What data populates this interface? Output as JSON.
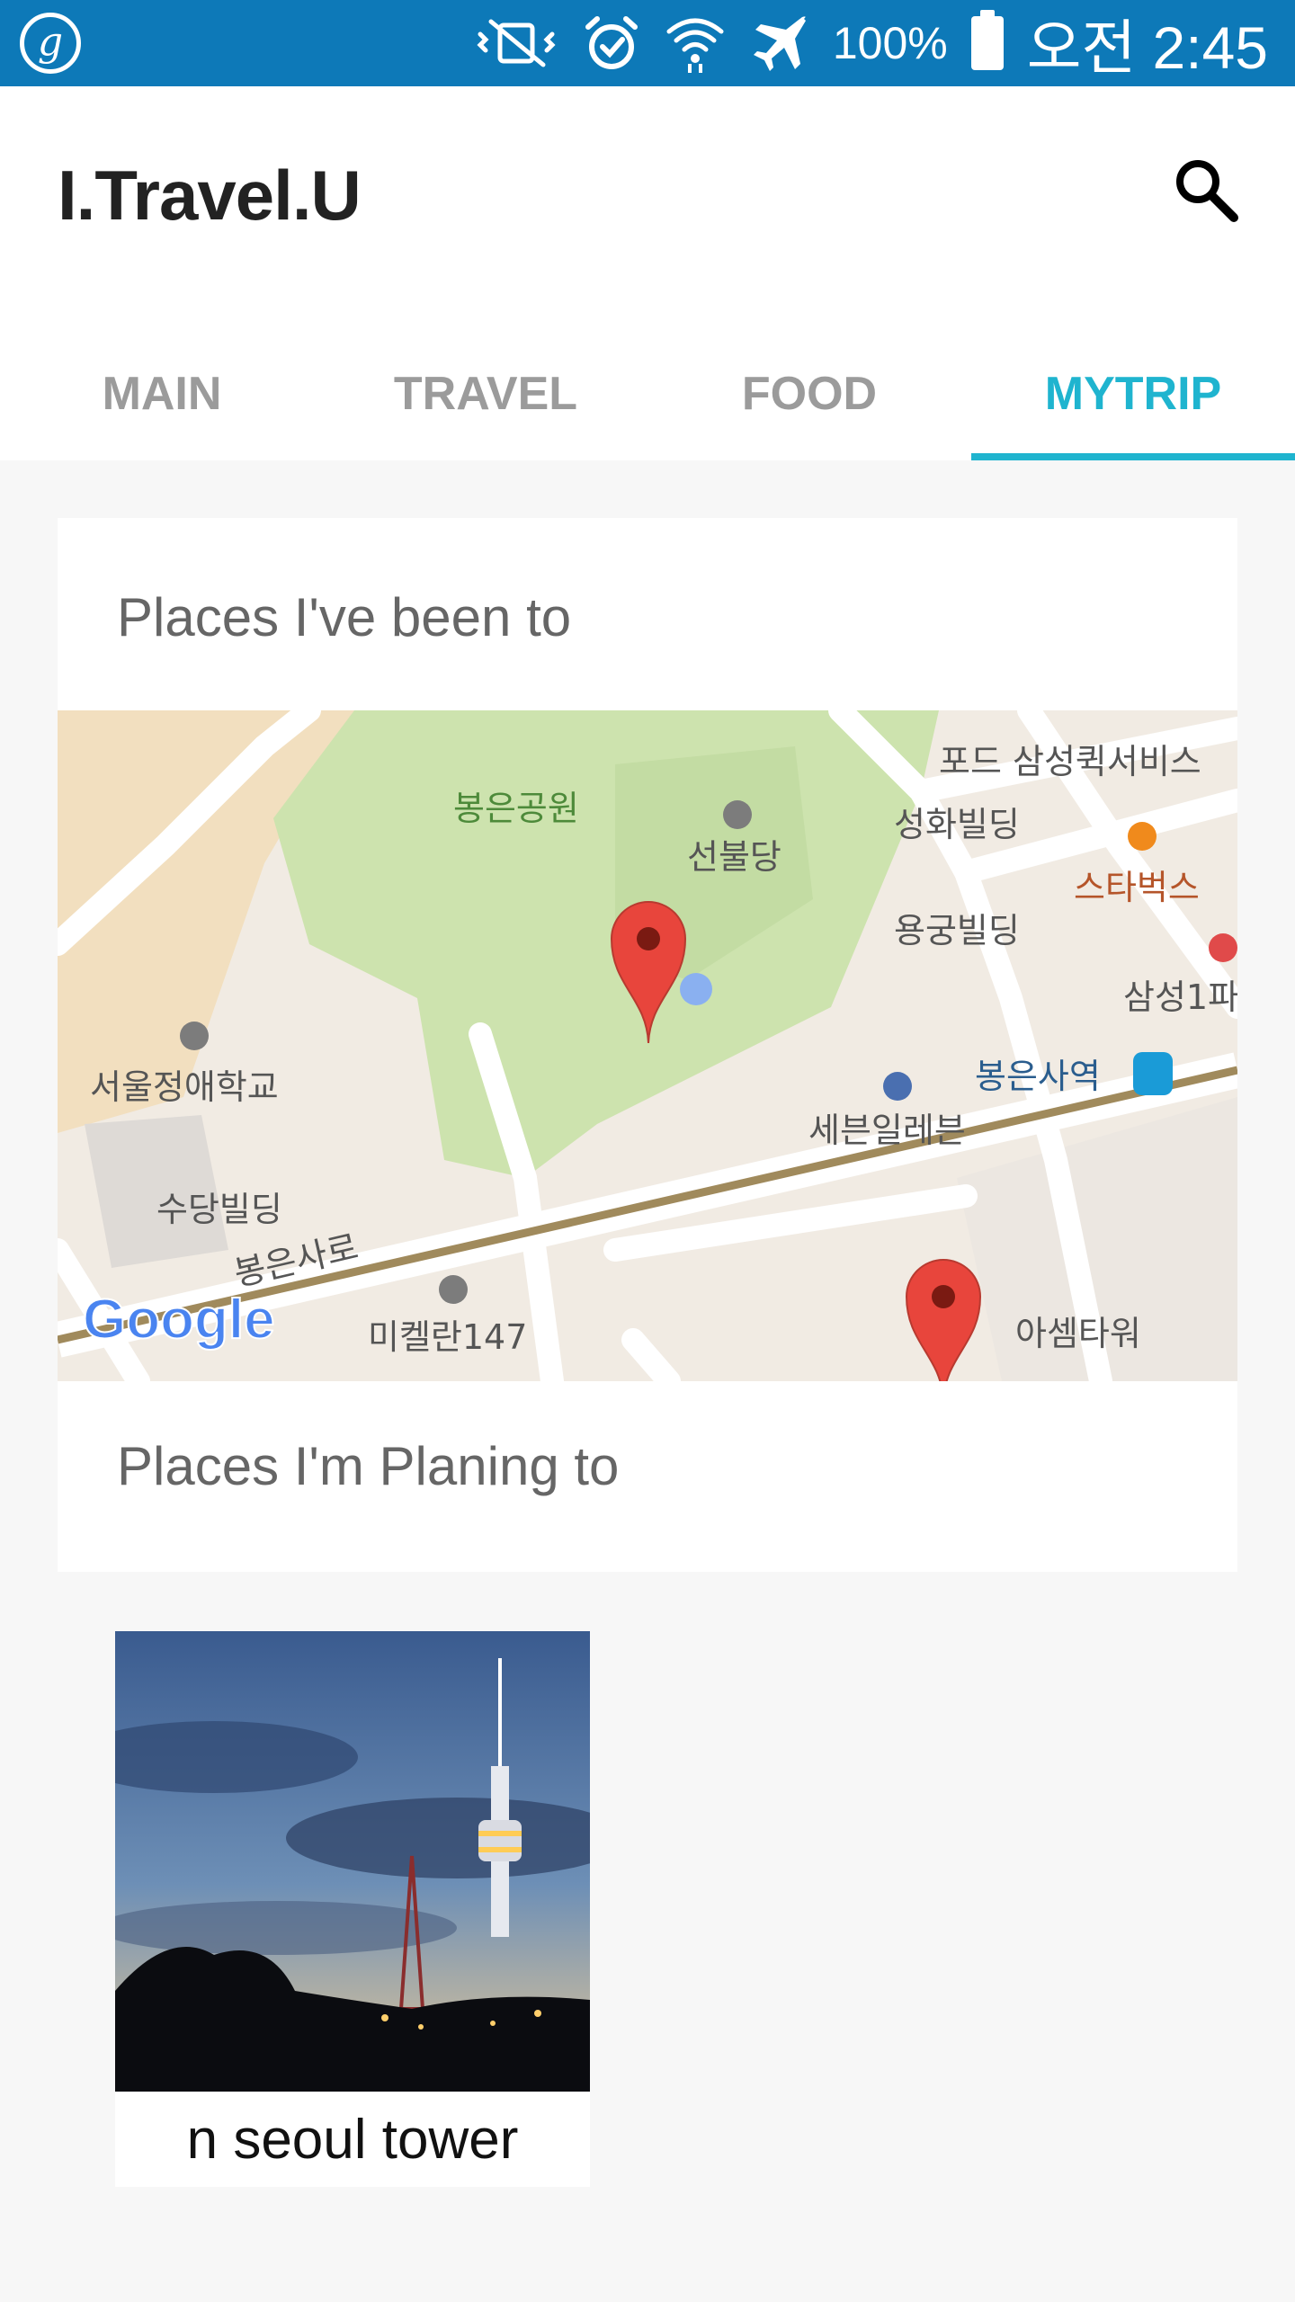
{
  "status_bar": {
    "battery_percent": "100%",
    "time": "오전 2:45",
    "background_color": "#0d79b8",
    "icons": [
      "g-app-icon",
      "mute-vibrate-icon",
      "alarm-icon",
      "wifi-icon",
      "airplane-icon",
      "battery-icon"
    ]
  },
  "app": {
    "title": "I.Travel.U",
    "search_icon": "search-icon",
    "accent_color": "#1fb4cf"
  },
  "tabs": [
    {
      "label": "MAIN",
      "active": false
    },
    {
      "label": "TRAVEL",
      "active": false
    },
    {
      "label": "FOOD",
      "active": false
    },
    {
      "label": "MYTRIP",
      "active": true
    }
  ],
  "mytrip": {
    "visited_title": "Places I've been to",
    "planning_title": "Places I'm Planing to",
    "map": {
      "provider_logo": "Google",
      "labels": [
        "봉은공원",
        "선불당",
        "포드 삼성퀵서비스",
        "성화빌딩",
        "스타벅스",
        "용궁빌딩",
        "삼성1파",
        "서울정애학교",
        "봉은사역",
        "세븐일레븐",
        "수당빌딩",
        "봉은사로",
        "미켈란147",
        "아셈타워"
      ]
    },
    "planned_places": [
      {
        "name": "n seoul tower"
      }
    ]
  }
}
